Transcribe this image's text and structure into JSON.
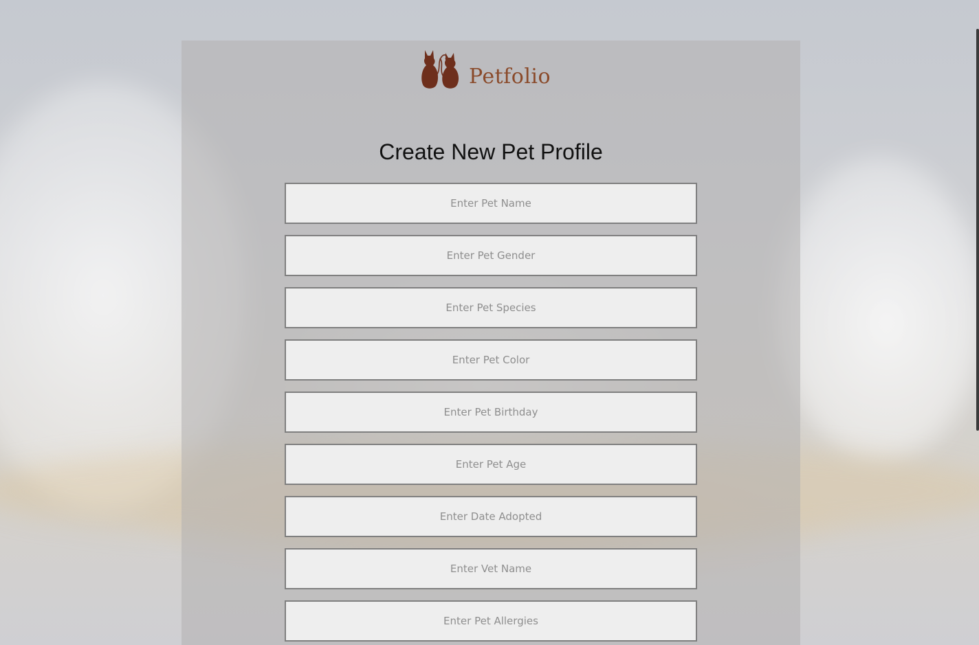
{
  "brand": {
    "name": "Petfolio",
    "logo_icon": "two-cats-logo-icon",
    "color": "#8a4a2a"
  },
  "form": {
    "title": "Create New Pet Profile",
    "fields": [
      {
        "name": "pet-name-input",
        "placeholder": "Enter Pet Name",
        "value": ""
      },
      {
        "name": "pet-gender-input",
        "placeholder": "Enter Pet Gender",
        "value": ""
      },
      {
        "name": "pet-species-input",
        "placeholder": "Enter Pet Species",
        "value": ""
      },
      {
        "name": "pet-color-input",
        "placeholder": "Enter Pet Color",
        "value": ""
      },
      {
        "name": "pet-birthday-input",
        "placeholder": "Enter Pet Birthday",
        "value": ""
      },
      {
        "name": "pet-age-input",
        "placeholder": "Enter Pet Age",
        "value": ""
      },
      {
        "name": "date-adopted-input",
        "placeholder": "Enter Date Adopted",
        "value": ""
      },
      {
        "name": "vet-name-input",
        "placeholder": "Enter Vet Name",
        "value": ""
      },
      {
        "name": "pet-allergies-input",
        "placeholder": "Enter Pet Allergies",
        "value": ""
      }
    ]
  },
  "colors": {
    "panel": "#b2b1b1",
    "field_bg": "#eeeeee",
    "field_border": "#7f7f7f",
    "title": "#111111"
  }
}
